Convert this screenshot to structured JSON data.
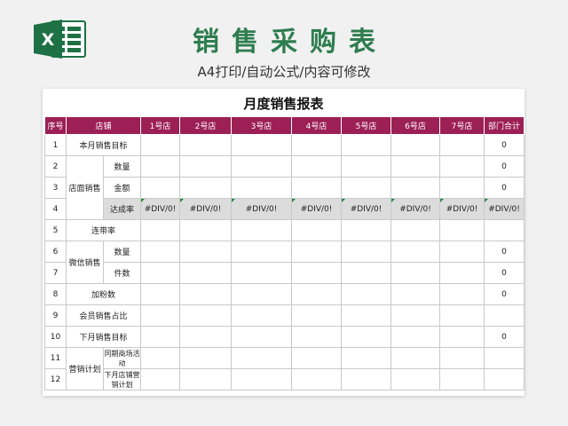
{
  "header": {
    "title": "销售采购表",
    "subtitle": "A4打印/自动公式/内容可修改",
    "logo_letter": "X"
  },
  "sheet": {
    "title": "月度销售报表",
    "columns": [
      "序号",
      "店铺",
      "1号店",
      "2号店",
      "3号店",
      "4号店",
      "5号店",
      "6号店",
      "7号店",
      "部门合计"
    ],
    "rows": {
      "r1": {
        "no": "1",
        "label": "本月销售目标",
        "total": "0"
      },
      "r2": {
        "no": "2",
        "group": "店面销售",
        "sub": "数量",
        "total": "0"
      },
      "r3": {
        "no": "3",
        "sub": "金额",
        "total": "0"
      },
      "r4": {
        "no": "4",
        "sub": "达成率",
        "value": "#DIV/0!"
      },
      "r5": {
        "no": "5",
        "label": "连带率"
      },
      "r6": {
        "no": "6",
        "group": "微信销售",
        "sub": "数量",
        "total": "0"
      },
      "r7": {
        "no": "7",
        "sub": "件数",
        "total": "0"
      },
      "r8": {
        "no": "8",
        "label": "加粉数",
        "total": "0"
      },
      "r9": {
        "no": "9",
        "label": "会员销售占比"
      },
      "r10": {
        "no": "10",
        "label": "下月销售目标",
        "total": "0"
      },
      "r11": {
        "no": "11",
        "group": "营销计划",
        "sub": "同期商场活动"
      },
      "r12": {
        "no": "12",
        "sub": "下月店铺营销计划"
      }
    }
  },
  "colors": {
    "header_bg": "#9c1f55",
    "title_green": "#2e7d4f",
    "excel_green": "#1e7145",
    "row_highlight": "#dcdcdc"
  },
  "icons": {
    "logo": "excel-logo-icon"
  }
}
